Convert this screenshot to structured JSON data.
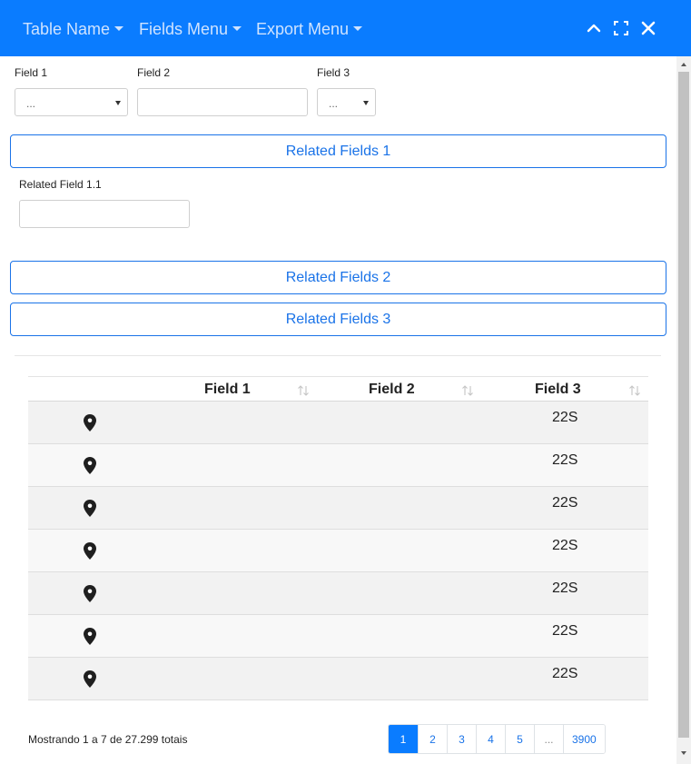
{
  "menubar": {
    "table_name": "Table Name",
    "fields_menu": "Fields Menu",
    "export_menu": "Export Menu",
    "icons": [
      "chevron-up-icon",
      "fullscreen-icon",
      "close-icon"
    ]
  },
  "filters": {
    "field1": {
      "label": "Field 1",
      "value": "..."
    },
    "field2": {
      "label": "Field 2",
      "value": ""
    },
    "field3": {
      "label": "Field 3",
      "value": "..."
    }
  },
  "related": {
    "group1": {
      "label": "Related Fields 1",
      "field_label": "Related Field 1.1",
      "field_value": ""
    },
    "group2": {
      "label": "Related Fields 2"
    },
    "group3": {
      "label": "Related Fields 3"
    }
  },
  "table": {
    "columns": [
      "Field 1",
      "Field 2",
      "Field 3"
    ],
    "rows": [
      {
        "icon": "map-pin-icon",
        "field1": "",
        "field2": "",
        "field3": "22S"
      },
      {
        "icon": "map-pin-icon",
        "field1": "",
        "field2": "",
        "field3": "22S"
      },
      {
        "icon": "map-pin-icon",
        "field1": "",
        "field2": "",
        "field3": "22S"
      },
      {
        "icon": "map-pin-icon",
        "field1": "",
        "field2": "",
        "field3": "22S"
      },
      {
        "icon": "map-pin-icon",
        "field1": "",
        "field2": "",
        "field3": "22S"
      },
      {
        "icon": "map-pin-icon",
        "field1": "",
        "field2": "",
        "field3": "22S"
      },
      {
        "icon": "map-pin-icon",
        "field1": "",
        "field2": "",
        "field3": "22S"
      }
    ]
  },
  "pagination": {
    "info": "Mostrando 1 a 7 de 27.299 totais",
    "pages": [
      "1",
      "2",
      "3",
      "4",
      "5",
      "...",
      "3900"
    ],
    "active": "1"
  },
  "colors": {
    "topbar": "#0a7cff",
    "menu_text": "#cfe3ff",
    "accent": "#1a73e8",
    "row_odd": "#f2f2f2",
    "row_even": "#f8f8f8"
  }
}
